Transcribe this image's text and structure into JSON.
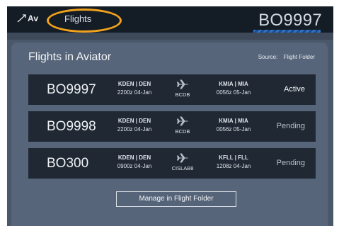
{
  "topbar": {
    "brand_text": "Av",
    "flights_tab_label": "Flights",
    "current_flight": "BO9997"
  },
  "modal": {
    "title": "Flights in Aviator",
    "source_label": "Source:",
    "source_value": "Flight Folder",
    "manage_button_label": "Manage in Flight Folder"
  },
  "flights": [
    {
      "flight_id": "BO9997",
      "dep_route": "KDEN | DEN",
      "dep_time": "2200z 04-Jan",
      "tail": "BCDB",
      "arr_route": "KMIA | MIA",
      "arr_time": "0056z 05-Jan",
      "status": "Active"
    },
    {
      "flight_id": "BO9998",
      "dep_route": "KDEN | DEN",
      "dep_time": "2200z 04-Jan",
      "tail": "BCDB",
      "arr_route": "KMIA | MIA",
      "arr_time": "0056z 05-Jan",
      "status": "Pending"
    },
    {
      "flight_id": "BO300",
      "dep_route": "KDEN | DEN",
      "dep_time": "0900z 04-Jan",
      "tail": "CISLAB8",
      "arr_route": "KFLL | FLL",
      "arr_time": "1208z 04-Jan",
      "status": "Pending"
    }
  ],
  "colors": {
    "highlight_ring": "#f2a21c",
    "topbar_bg": "#141c26",
    "row_bg": "#1f2833",
    "modal_bg": "#57657a"
  },
  "icons": {
    "brand": "aviator-logo-icon",
    "plane": "airplane-icon"
  }
}
